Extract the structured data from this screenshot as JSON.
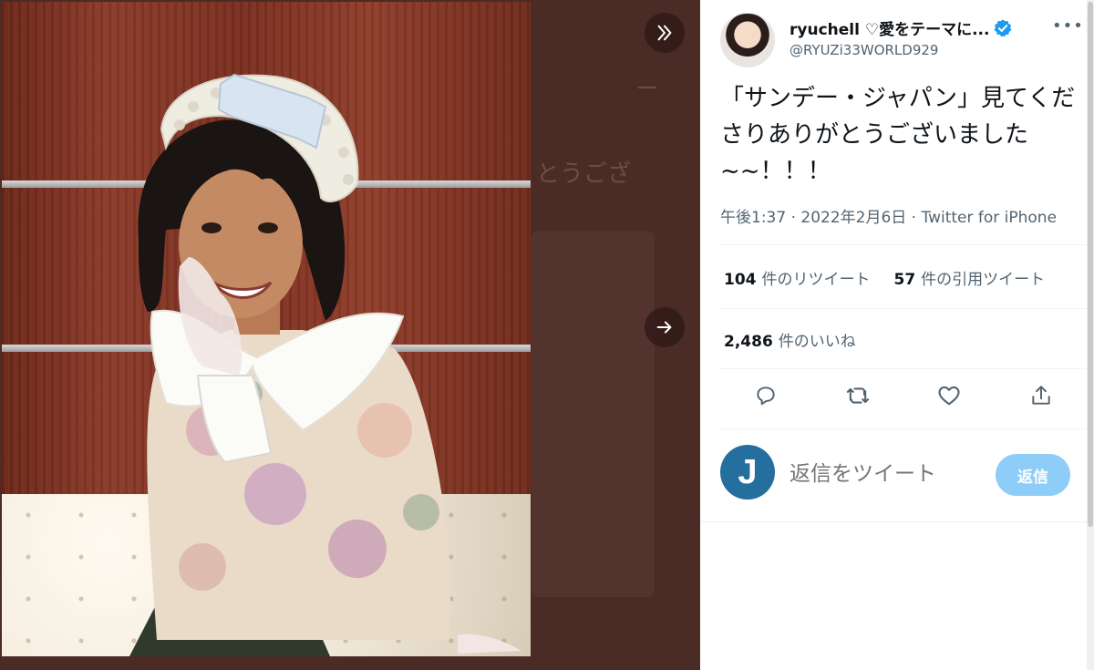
{
  "viewer": {
    "ghost_text": "とうござ"
  },
  "tweet": {
    "display_name": "ryuchell ♡愛をテーマに...",
    "handle": "@RYUZi33WORLD929",
    "more_label": "•••",
    "text": "「サンデー・ジャパン」見てくださりありがとうございました~~！！！",
    "timestamp": "午後1:37 · 2022年2月6日 · Twitter for iPhone",
    "retweets_count": "104",
    "retweets_label": "件のリツイート",
    "quotes_count": "57",
    "quotes_label": "件の引用ツイート",
    "likes_count": "2,486",
    "likes_label": "件のいいね"
  },
  "reply": {
    "avatar_letter": "J",
    "placeholder": "返信をツイート",
    "button_label": "返信"
  },
  "icons": {
    "expand": "double-chevron-right-icon",
    "next": "arrow-right-icon",
    "verified": "verified-badge-icon",
    "reply": "reply-icon",
    "retweet": "retweet-icon",
    "like": "heart-icon",
    "share": "share-icon"
  },
  "colors": {
    "accent": "#1d9bf0",
    "reply_button": "#8ecdf7",
    "text_primary": "#0f1419",
    "text_secondary": "#536471",
    "backdrop": "#4b2b26"
  }
}
